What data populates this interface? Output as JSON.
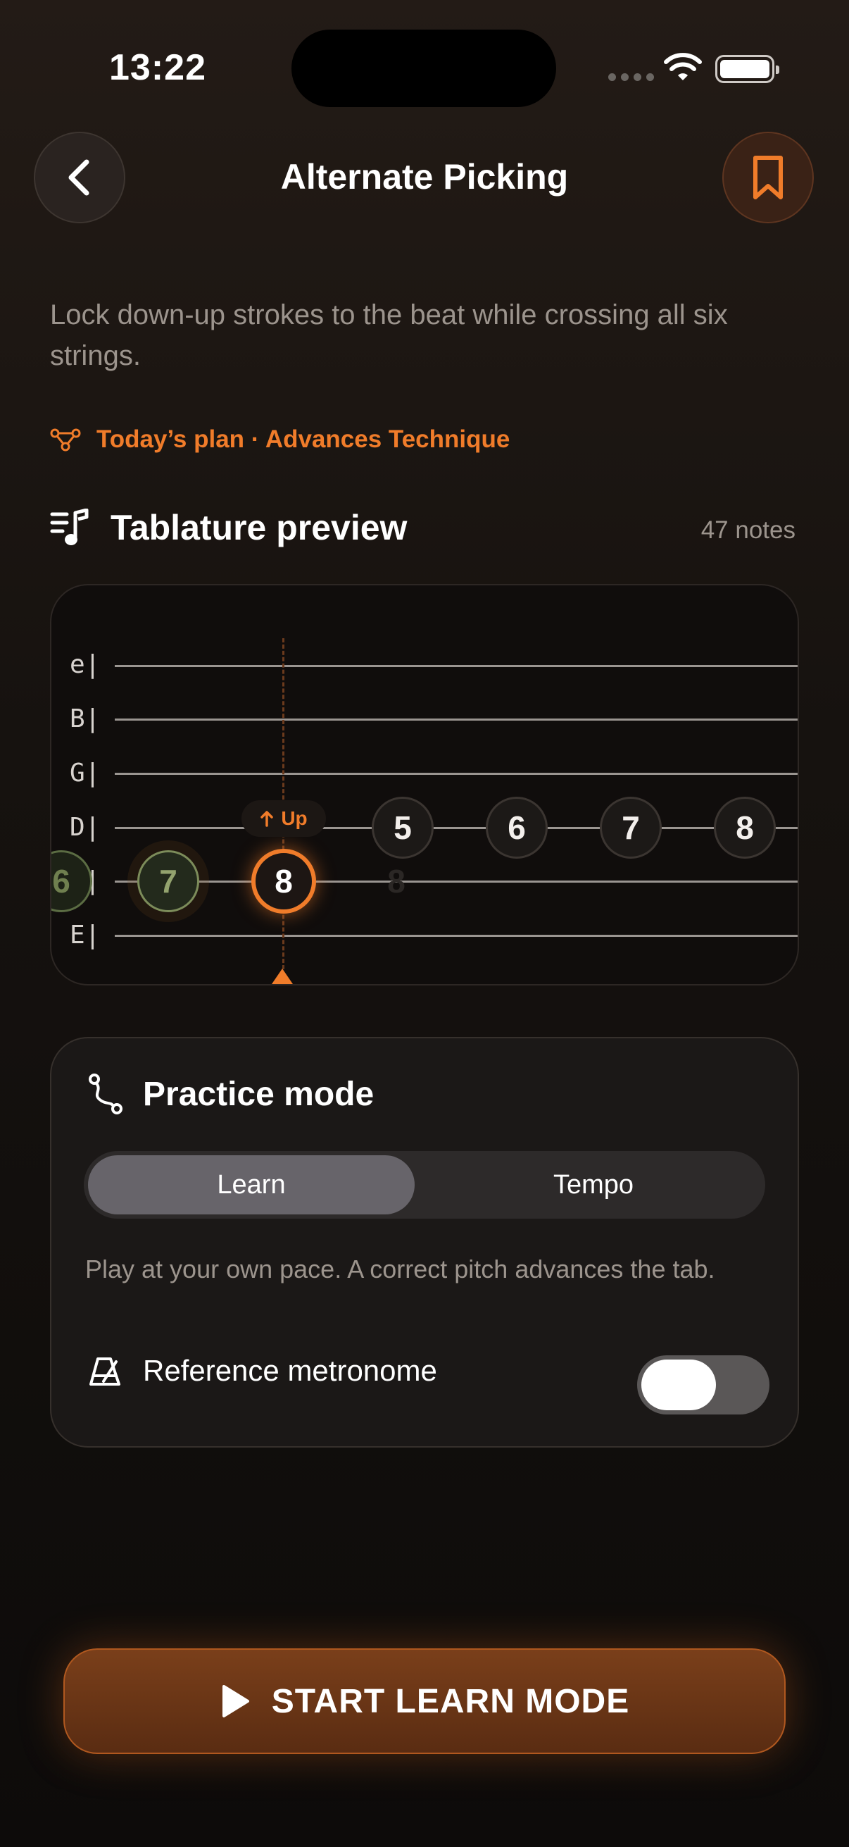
{
  "status_bar": {
    "time": "13:22"
  },
  "header": {
    "title": "Alternate Picking"
  },
  "lesson": {
    "description": "Lock down-up strokes to the beat while crossing all six strings.",
    "plan": "Today’s plan · Advances Technique"
  },
  "tab_section": {
    "title": "Tablature preview",
    "note_count": "47 notes",
    "strings": [
      "e|",
      "B|",
      "G|",
      "D|",
      "A|",
      "E|"
    ],
    "pick_direction": "Up",
    "notes": {
      "a_far": "6",
      "a_past": "7",
      "a_active": "8",
      "a_ghost": "8",
      "d_1": "5",
      "d_2": "6",
      "d_3": "7",
      "d_4": "8"
    }
  },
  "practice": {
    "title": "Practice mode",
    "modes": [
      "Learn",
      "Tempo"
    ],
    "selected_mode": "Learn",
    "description": "Play at your own pace. A correct pitch advances the tab.",
    "metronome_label": "Reference metronome",
    "metronome_on": false
  },
  "cta": {
    "label": "START LEARN MODE"
  },
  "colors": {
    "accent": "#f07c2a",
    "past_note": "#93a36e",
    "background": "#16120f"
  },
  "icons": [
    "back-chevron-icon",
    "bookmark-icon",
    "plan-nodes-icon",
    "music-list-icon",
    "route-icon",
    "metronome-icon",
    "play-icon",
    "arrow-up-icon",
    "wifi-icon",
    "battery-icon"
  ]
}
